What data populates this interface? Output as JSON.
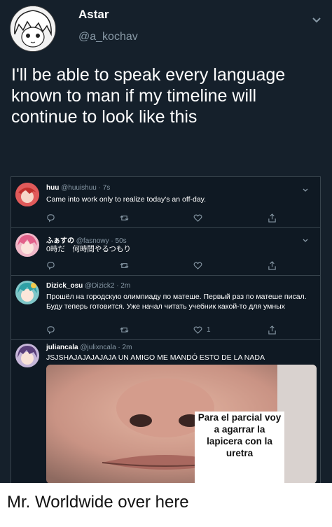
{
  "main_tweet": {
    "name": "Astar",
    "handle": "@a_kochav",
    "text": "I'll be able to speak every language known to man if my timeline will continue to look like this"
  },
  "quoted_tweets": [
    {
      "name": "huu",
      "handle": "@huuishuu · 7s",
      "text": "Came into work only to realize today's an off-day."
    },
    {
      "name": "ふぁすの",
      "handle": "@fasnowy · 50s",
      "text": "0時だ　何時間やるつもり"
    },
    {
      "name": "Dizick_osu",
      "handle": "@Dizick2 · 2m",
      "text": "Прошёл на городскую олимпиаду по матеше. Первый раз по матеше писал. Буду теперь готовится. Уже начал читать учебник какой-то для умных",
      "like_count": "1"
    },
    {
      "name": "juliancala",
      "handle": "@julixncala · 2m",
      "text": "JSJSHAJAJAJAJAJA UN AMIGO ME MANDÓ ESTO DE LA NADA",
      "image_caption": [
        "Para el parcial voy",
        "a agarrar la",
        "lapicera con la",
        "uretra"
      ]
    }
  ],
  "bottom_caption": "Mr. Worldwide over here",
  "colors": {
    "background": "#15202b",
    "secondary_text": "#8899a6",
    "border": "#38444d"
  }
}
